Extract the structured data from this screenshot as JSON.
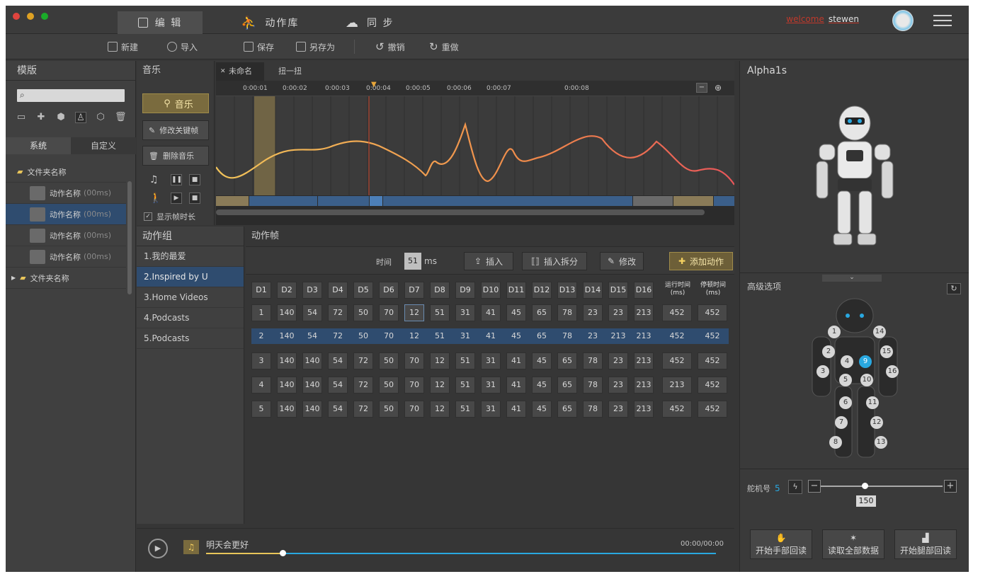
{
  "titlebar": {
    "tabs": [
      {
        "label": "编 辑"
      },
      {
        "label": "动作库"
      },
      {
        "label": "同 步"
      }
    ],
    "welcome": "welcome",
    "user": "stewen"
  },
  "toolbar": {
    "new": "新建",
    "import": "导入",
    "save": "保存",
    "save_as": "另存为",
    "undo": "撤销",
    "redo": "重做"
  },
  "left": {
    "title": "模版",
    "tabs": [
      "系统",
      "自定义"
    ],
    "folder1": "文件夹名称",
    "items": [
      {
        "name": "动作名称",
        "time": "(00ms)"
      },
      {
        "name": "动作名称",
        "time": "(00ms)"
      },
      {
        "name": "动作名称",
        "time": "(00ms)"
      },
      {
        "name": "动作名称",
        "time": "(00ms)"
      }
    ],
    "folder2": "文件夹名称"
  },
  "music": {
    "title": "音乐",
    "btn_music": "音乐",
    "btn_edit": "修改关键帧",
    "btn_delete": "删除音乐",
    "show_time": "显示帧时长"
  },
  "timeline": {
    "tabs": [
      "未命名",
      "扭一扭"
    ],
    "ticks": [
      "0:00:01",
      "0:00:02",
      "0:00:03",
      "0:00:04",
      "0:00:05",
      "0:00:06",
      "0:00:07",
      "0:00:08"
    ]
  },
  "group": {
    "title": "动作组",
    "items": [
      "1.我的最爱",
      "2.Inspired by U",
      "3.Home Videos",
      "4.Podcasts",
      "5.Podcasts"
    ]
  },
  "frame": {
    "title": "动作帧",
    "time_label": "时间",
    "time_value": "51",
    "unit": "ms",
    "insert": "插入",
    "insert_split": "插入拆分",
    "modify": "修改",
    "add": "添加动作",
    "headers": [
      "D1",
      "D2",
      "D3",
      "D4",
      "D5",
      "D6",
      "D7",
      "D8",
      "D9",
      "D10",
      "D11",
      "D12",
      "D13",
      "D14",
      "D15",
      "D16"
    ],
    "run_time": "运行时间\n(ms)",
    "stop_time": "停顿时间\n(ms)",
    "rows": [
      {
        "id": "1",
        "vals": [
          "140",
          "54",
          "72",
          "50",
          "70",
          "12",
          "51",
          "31",
          "41",
          "45",
          "65",
          "78",
          "23",
          "23",
          "213"
        ],
        "run": "452",
        "stop": "452"
      },
      {
        "id": "2",
        "vals": [
          "140",
          "54",
          "72",
          "50",
          "70",
          "12",
          "51",
          "31",
          "41",
          "45",
          "65",
          "78",
          "23",
          "213",
          "213"
        ],
        "run": "452",
        "stop": "452"
      },
      {
        "id": "3",
        "vals": [
          "140",
          "140",
          "54",
          "72",
          "50",
          "70",
          "12",
          "51",
          "31",
          "41",
          "45",
          "65",
          "78",
          "23",
          "213"
        ],
        "run": "452",
        "stop": "452"
      },
      {
        "id": "4",
        "vals": [
          "140",
          "140",
          "54",
          "72",
          "50",
          "70",
          "12",
          "51",
          "31",
          "41",
          "45",
          "65",
          "78",
          "23",
          "213"
        ],
        "run": "213",
        "stop": "452"
      },
      {
        "id": "5",
        "vals": [
          "140",
          "140",
          "54",
          "72",
          "50",
          "70",
          "12",
          "51",
          "31",
          "41",
          "45",
          "65",
          "78",
          "23",
          "213"
        ],
        "run": "452",
        "stop": "452"
      }
    ]
  },
  "right": {
    "title": "Alpha1s",
    "advanced": "高级选项",
    "servo_label": "舵机号",
    "servo_value": "5",
    "angle": "150",
    "btn_hand": "开始手部回读",
    "btn_all": "读取全部数据",
    "btn_leg": "开始腿部回读",
    "joints": [
      "1",
      "2",
      "3",
      "4",
      "5",
      "6",
      "7",
      "8",
      "9",
      "10",
      "11",
      "12",
      "13",
      "14",
      "15",
      "16"
    ]
  },
  "player": {
    "song": "明天会更好",
    "time": "00:00/00:00"
  },
  "colors": {
    "accent": "#2f4c6f",
    "gold": "#7a6b3e",
    "wave": "#e8a44a",
    "highlight": "#29a8e0"
  }
}
